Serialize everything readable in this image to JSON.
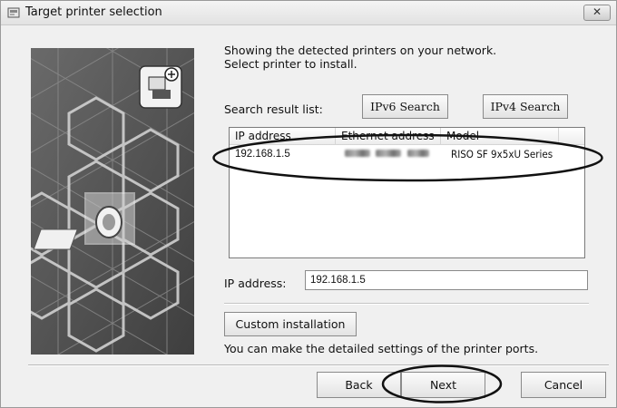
{
  "window": {
    "title": "Target printer selection",
    "close_label": "✕"
  },
  "intro": {
    "line1": "Showing the detected printers on your network.",
    "line2": "Select printer to install."
  },
  "search": {
    "label": "Search result list:",
    "ipv6_button": "IPv6 Search",
    "ipv4_button": "IPv4 Search"
  },
  "printer_list": {
    "columns": [
      "IP address",
      "Ethernet address",
      "Model"
    ],
    "rows": [
      {
        "ip": "192.168.1.5",
        "model": "RISO SF 9x5xU Series"
      }
    ]
  },
  "ip_field": {
    "label": "IP address:",
    "value": "192.168.1.5"
  },
  "custom": {
    "button": "Custom installation",
    "description": "You can make the detailed settings of the printer ports."
  },
  "footer": {
    "back": "Back",
    "next": "Next",
    "cancel": "Cancel"
  }
}
